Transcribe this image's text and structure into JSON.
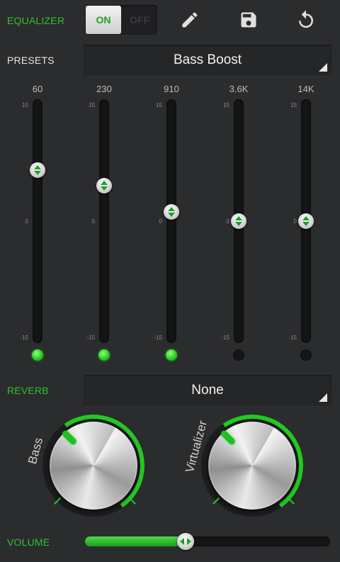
{
  "equalizer": {
    "label": "EQUALIZER",
    "toggle_on": "ON",
    "toggle_off": "OFF",
    "enabled": true
  },
  "toolbar": {
    "edit_icon": "pencil-icon",
    "save_icon": "save-icon",
    "reset_icon": "reset-icon"
  },
  "presets": {
    "label": "PRESETS",
    "selected": "Bass Boost"
  },
  "bands": [
    {
      "freq": "60",
      "max": "15",
      "zero": "0",
      "min": "-15",
      "level": 6.5,
      "active": true
    },
    {
      "freq": "230",
      "max": "15",
      "zero": "0",
      "min": "-15",
      "level": 4.5,
      "active": true
    },
    {
      "freq": "910",
      "max": "15",
      "zero": "0",
      "min": "-15",
      "level": 1.2,
      "active": true
    },
    {
      "freq": "3.6K",
      "max": "15",
      "zero": "0",
      "min": "-15",
      "level": 0,
      "active": false
    },
    {
      "freq": "14K",
      "max": "15",
      "zero": "0",
      "min": "-15",
      "level": 0,
      "active": false
    }
  ],
  "band_range": [
    -15,
    15
  ],
  "reverb": {
    "label": "REVERB",
    "selected": "None"
  },
  "knobs": {
    "bass_label": "Bass",
    "virtualizer_label": "Virtualizer"
  },
  "volume": {
    "label": "VOLUME",
    "level": 0.41
  },
  "colors": {
    "accent": "#22c91f",
    "background": "#2b2c2e"
  }
}
